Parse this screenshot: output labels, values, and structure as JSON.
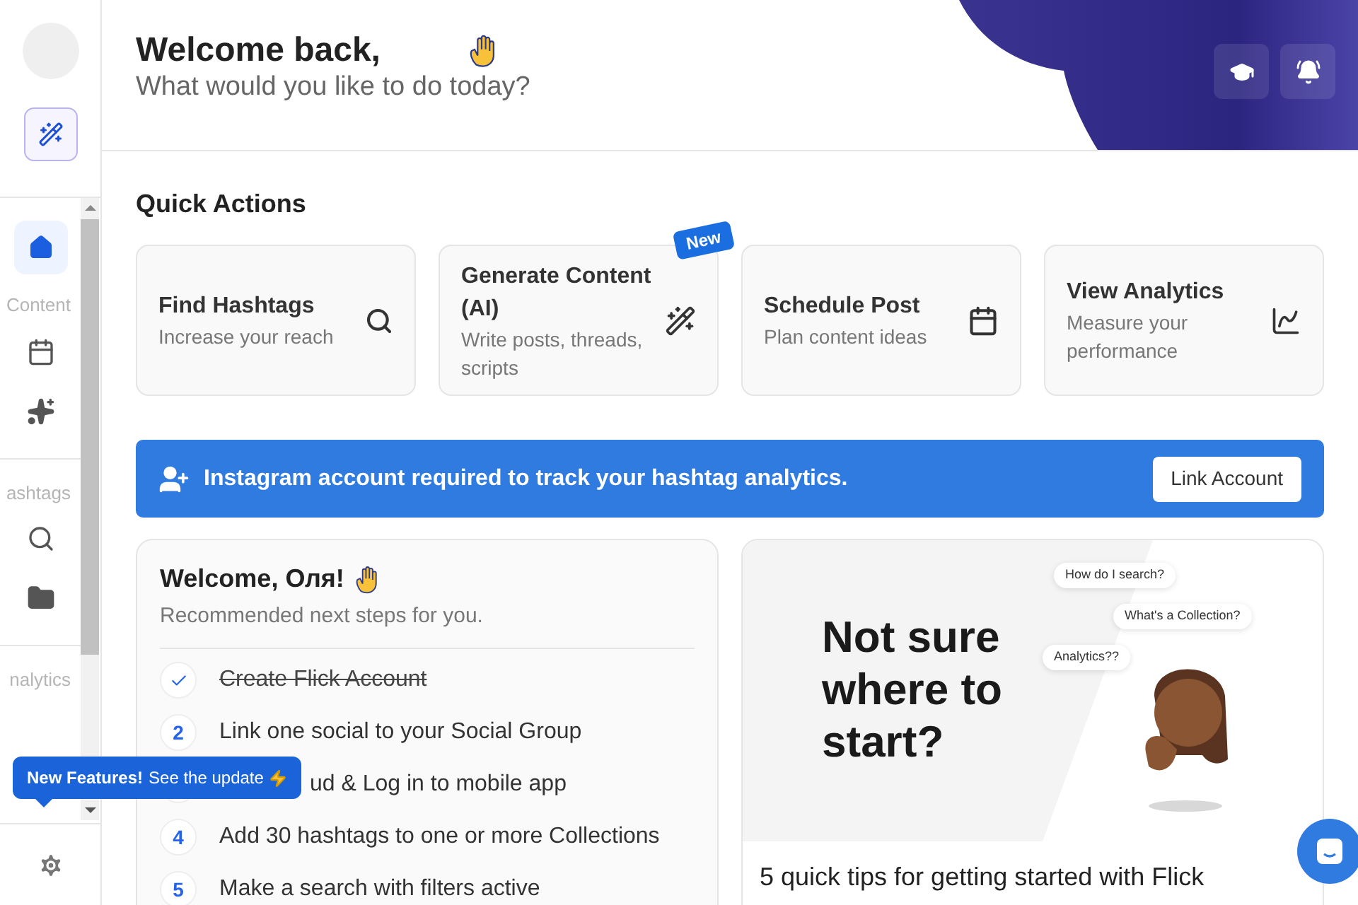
{
  "sidebar": {
    "nav": [
      {
        "kind": "item",
        "selected": true
      },
      {
        "kind": "label",
        "label": "Content"
      },
      {
        "kind": "item",
        "selected": false
      },
      {
        "kind": "item",
        "selected": false
      },
      {
        "kind": "divider"
      },
      {
        "kind": "label",
        "label": "ashtags"
      },
      {
        "kind": "item",
        "selected": false
      },
      {
        "kind": "item",
        "selected": false
      },
      {
        "kind": "divider"
      },
      {
        "kind": "label",
        "label": "nalytics"
      }
    ]
  },
  "header": {
    "title": "Welcome back,",
    "subtitle": "What would you like to do today?"
  },
  "quick_actions": {
    "title": "Quick Actions",
    "cards": [
      {
        "title": "Find Hashtags",
        "subtitle": "Increase your reach"
      },
      {
        "title": "Generate Content (AI)",
        "subtitle": "Write posts, threads, scripts",
        "badge": "New"
      },
      {
        "title": "Schedule Post",
        "subtitle": "Plan content ideas"
      },
      {
        "title": "View Analytics",
        "subtitle": "Measure your performance"
      }
    ]
  },
  "banner": {
    "text": "Instagram account required to track your hashtag analytics.",
    "button": "Link Account"
  },
  "checklist": {
    "title": "Welcome, Оля!",
    "subtitle": "Recommended next steps for you.",
    "steps": [
      {
        "text": "Create Flick Account",
        "checked": true
      },
      {
        "number": "2",
        "text": "Link one social to your Social Group",
        "checked": false
      },
      {
        "text": "ud & Log in to mobile app",
        "checked": false
      },
      {
        "number": "4",
        "text": "Add 30 hashtags to one or more Collections",
        "checked": false
      },
      {
        "number": "5",
        "text": "Make a search with filters active",
        "checked": false
      }
    ]
  },
  "tips": {
    "headline": "Not sure where to start?",
    "bubbles": [
      "How do I search?",
      "What's a Collection?",
      "Analytics??"
    ],
    "title": "5 quick tips for getting started with Flick"
  },
  "tooltip": {
    "title": "New Features!",
    "text": "See the update"
  }
}
